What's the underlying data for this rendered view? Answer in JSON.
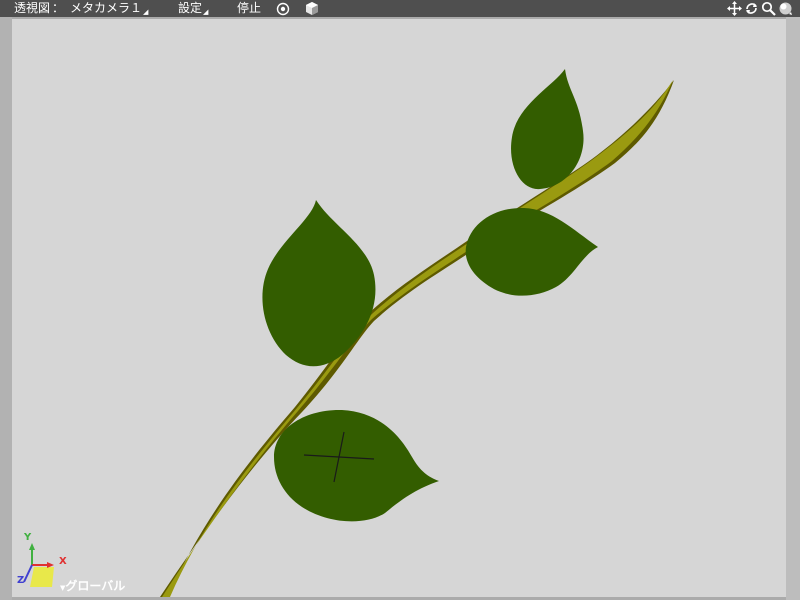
{
  "toolbar": {
    "view_mode": "透視図",
    "separator": "：",
    "camera_name": "メタカメラ１",
    "settings_label": "設定",
    "stop_label": "停止",
    "icons": [
      "target-icon",
      "cube-icon",
      "move-icon",
      "rotate-icon",
      "zoom-icon",
      "sphere-icon"
    ]
  },
  "axes": {
    "y_label": "Y",
    "x_label": "X",
    "z_label": "Z",
    "coordinate_mode": "グローバル",
    "colors": {
      "x": "#e03030",
      "y": "#40b040",
      "z": "#4040d0",
      "plane": "#e8e84a"
    }
  },
  "scene": {
    "objects": [
      "stem",
      "leaf-top",
      "leaf-upper-right",
      "leaf-middle-left",
      "leaf-bottom",
      "crosshair"
    ],
    "colors": {
      "background": "#d6d6d6",
      "leaf": "#335d00",
      "stem": "#9a9a10",
      "stem_shadow": "#5e5a00"
    }
  }
}
